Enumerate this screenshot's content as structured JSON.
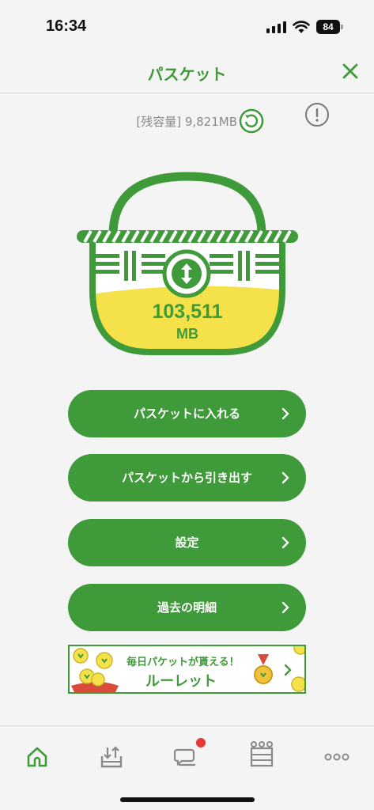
{
  "status_bar": {
    "time": "16:34",
    "battery": "84"
  },
  "header": {
    "title": "パスケット",
    "close_icon": "close-icon"
  },
  "remaining": {
    "label": "[残容量] 9,821MB"
  },
  "basket": {
    "amount": "103,511",
    "unit": "MB",
    "fill_level": 0.45
  },
  "menu": [
    {
      "label": "パスケットに入れる"
    },
    {
      "label": "パスケットから引き出す"
    },
    {
      "label": "設定"
    },
    {
      "label": "過去の明細"
    }
  ],
  "banner": {
    "line1": "毎日パケットが貰える！",
    "line2": "ルーレット"
  },
  "tabs": [
    {
      "icon": "home-icon",
      "active": true
    },
    {
      "icon": "basket-download-icon",
      "active": false
    },
    {
      "icon": "chat-icon",
      "badge": true,
      "active": false
    },
    {
      "icon": "crown-icon",
      "active": false
    },
    {
      "icon": "more-icon",
      "active": false
    }
  ],
  "colors": {
    "brand_green": "#3f9a3a",
    "basket_fill": "#f5e24a",
    "badge_red": "#e53935"
  }
}
